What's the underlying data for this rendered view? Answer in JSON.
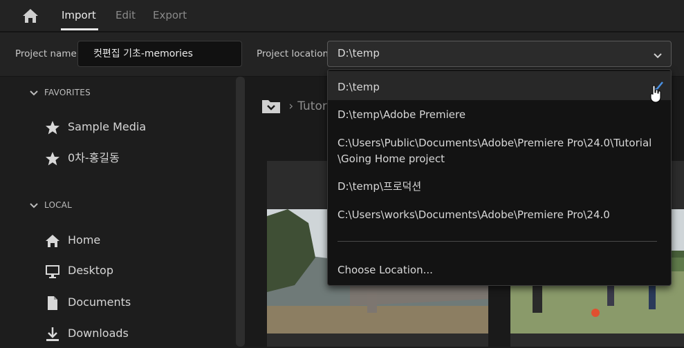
{
  "tabs": [
    {
      "label": "Import",
      "active": true
    },
    {
      "label": "Edit",
      "active": false
    },
    {
      "label": "Export",
      "active": false
    }
  ],
  "project": {
    "name_label": "Project name",
    "name_value": "컷편집 기초-memories",
    "location_label": "Project location",
    "location_value": "D:\\temp"
  },
  "sidebar": {
    "favorites_title": "FAVORITES",
    "favorites": [
      "Sample Media",
      "0차-홍길동"
    ],
    "local_title": "LOCAL",
    "local": [
      {
        "label": "Home",
        "icon": "home-icon"
      },
      {
        "label": "Desktop",
        "icon": "monitor-icon"
      },
      {
        "label": "Documents",
        "icon": "document-icon"
      },
      {
        "label": "Downloads",
        "icon": "download-icon"
      }
    ]
  },
  "breadcrumb": {
    "text": "Tutor"
  },
  "dropdown": {
    "options": [
      {
        "label": "D:\\temp",
        "selected": true
      },
      {
        "label": "D:\\temp\\Adobe Premiere"
      },
      {
        "label": "C:\\Users\\Public\\Documents\\Adobe\\Premiere Pro\\24.0\\Tutorial",
        "label2": "\\Going Home project"
      },
      {
        "label": "D:\\temp\\프로덕션"
      },
      {
        "label": "C:\\Users\\works\\Documents\\Adobe\\Premiere Pro\\24.0"
      }
    ],
    "choose_label": "Choose Location..."
  },
  "colors": {
    "accent": "#4a90e2",
    "background": "#1d1d1d"
  }
}
